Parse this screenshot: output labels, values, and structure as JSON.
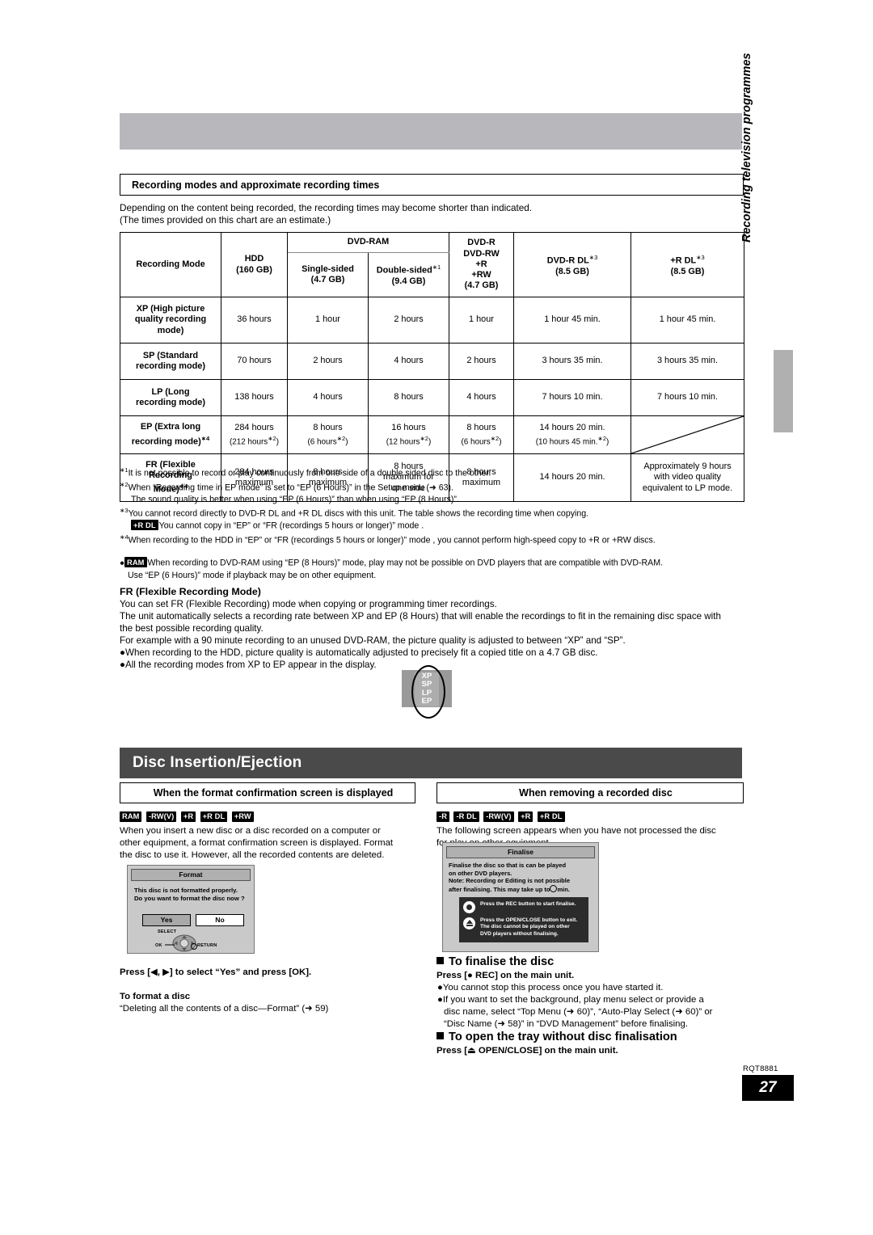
{
  "page": {
    "number": "27",
    "doc_code": "RQT8881",
    "side_tab": "Recording television programmes"
  },
  "section1": {
    "heading": "Recording modes and approximate recording times",
    "intro_line1": "Depending on the content being recorded, the recording times may become shorter than indicated.",
    "intro_line2": "(The times provided on this chart are an estimate.)"
  },
  "chart_data": {
    "type": "table",
    "title": "Recording modes and approximate recording times",
    "columns": [
      {
        "label": "Recording Mode",
        "sub": ""
      },
      {
        "label": "HDD",
        "sub": "(160 GB)"
      },
      {
        "group": "DVD-RAM",
        "label": "Single-sided",
        "sub": "(4.7 GB)"
      },
      {
        "group": "DVD-RAM",
        "label": "Double-sided",
        "footnote": "∗1",
        "sub": "(9.4 GB)"
      },
      {
        "label": "DVD-R\nDVD-RW\n+R\n+RW",
        "sub": "(4.7 GB)"
      },
      {
        "label": "DVD-R DL",
        "footnote": "∗3",
        "sub": "(8.5 GB)"
      },
      {
        "label": "+R DL",
        "footnote": "∗3",
        "sub": "(8.5 GB)"
      }
    ],
    "group_header": "DVD-RAM",
    "col_hdd": "HDD",
    "col_hdd_sub": "(160 GB)",
    "col_ss": "Single-sided",
    "col_ss_sub": "(4.7 GB)",
    "col_ds": "Double-sided",
    "col_ds_sub": "(9.4 GB)",
    "col_dvdr_l1": "DVD-R",
    "col_dvdr_l2": "DVD-RW",
    "col_dvdr_l3": "+R",
    "col_dvdr_l4": "+RW",
    "col_dvdr_sub": "(4.7 GB)",
    "col_dl": "DVD-R DL",
    "col_dl_sub": "(8.5 GB)",
    "col_rdl": "+R DL",
    "col_rdl_sub": "(8.5 GB)",
    "col_mode": "Recording Mode",
    "rows": [
      {
        "mode_l1": "XP (High picture",
        "mode_l2": "quality recording",
        "mode_l3": "mode)",
        "hdd": "36 hours",
        "single": "1 hour",
        "double": "2 hours",
        "dvdr": "1 hour",
        "dl": "1 hour 45 min.",
        "rdl": "1 hour 45 min."
      },
      {
        "mode_l1": "SP (Standard",
        "mode_l2": "recording mode)",
        "mode_l3": "",
        "hdd": "70 hours",
        "single": "2 hours",
        "double": "4 hours",
        "dvdr": "2 hours",
        "dl": "3 hours 35 min.",
        "rdl": "3 hours 35 min."
      },
      {
        "mode_l1": "LP (Long",
        "mode_l2": "recording mode)",
        "mode_l3": "",
        "hdd": "138 hours",
        "single": "4 hours",
        "double": "8 hours",
        "dvdr": "4 hours",
        "dl": "7 hours 10 min.",
        "rdl": "7 hours 10 min."
      },
      {
        "mode_l1": "EP (Extra long",
        "mode_l2": "recording mode)",
        "mode_l3": "",
        "mode_fn": "∗4",
        "hdd": "284 hours",
        "hdd2": "(212 hours",
        "hdd2fn": "∗2",
        "hdd2end": ")",
        "single": "8 hours",
        "single2": "(6 hours",
        "single2fn": "∗2",
        "single2end": ")",
        "double": "16 hours",
        "double2": "(12 hours",
        "double2fn": "∗2",
        "double2end": ")",
        "dvdr": "8 hours",
        "dvdr2": "(6 hours",
        "dvdr2fn": "∗2",
        "dvdr2end": ")",
        "dl": "14 hours 20 min.",
        "dl2": "(10 hours 45 min.",
        "dl2fn": "∗2",
        "dl2end": ")",
        "rdl": ""
      },
      {
        "mode_l1": "FR (Flexible",
        "mode_l2": "Recording",
        "mode_l3": "Mode)",
        "mode_fn": "∗4",
        "hdd": "284 hours",
        "hdd2": "maximum",
        "single": "8 hours",
        "single2": "maximum",
        "double": "8 hours",
        "double2": "maximum for",
        "double3": "one side",
        "dvdr": "8 hours",
        "dvdr2": "maximum",
        "dl": "14 hours 20 min.",
        "rdl": "Approximately 9 hours",
        "rdl2": "with video quality",
        "rdl3": "equivalent to LP mode."
      }
    ]
  },
  "footnotes": [
    {
      "num": "∗1",
      "text": "It is not possible to record or play continuously from one side of a double sided disc to the other."
    },
    {
      "num": "∗2",
      "text": "When “Recording time in EP mode” is set to “EP (6 Hours)” in the Setup menu (➜ 63).",
      "cont": "The sound quality is better when using “EP (6 Hours)” than when using “EP (8 Hours)”."
    },
    {
      "num": "∗3",
      "text": "You cannot record directly to DVD-R DL and +R DL discs with this unit. The table shows the recording time when copying.",
      "badge": "+R DL",
      "cont": "You cannot copy in “EP” or “FR (recordings 5 hours or longer)” mode ."
    },
    {
      "num": "∗4",
      "text": "When recording to the HDD in “EP” or “FR (recordings 5 hours or longer)” mode , you cannot perform high-speed copy to +R or +RW discs."
    }
  ],
  "ram_note": {
    "bullet": "●",
    "badge": "RAM",
    "line1": "When recording to DVD-RAM using “EP (8 Hours)” mode, play may not be possible on DVD players that are compatible with DVD-RAM.",
    "line2": "Use “EP (6 Hours)” mode if playback may be on other equipment."
  },
  "fr_section": {
    "heading": "FR (Flexible Recording Mode)",
    "p1": "You can set FR (Flexible Recording) mode when copying or programming timer recordings.",
    "p2": "The unit automatically selects a recording rate between XP and EP (8 Hours) that will enable the recordings to fit in the remaining disc space with",
    "p3": "the best possible recording quality.",
    "p4": "For example with a 90 minute recording to an unused DVD-RAM, the picture quality is adjusted to between “XP” and “SP”.",
    "b1": "●When recording to the HDD, picture quality is automatically adjusted to precisely fit a copied title on a 4.7 GB disc.",
    "b2": "●All the recording modes from XP to EP appear in the display.",
    "display_modes": "XP\nSP\nLP\nEP"
  },
  "section2": {
    "title": "Disc Insertion/Ejection"
  },
  "left_col": {
    "heading": "When the format confirmation screen is displayed",
    "badges": [
      "RAM",
      "-RW(V)",
      "+R",
      "+R DL",
      "+RW"
    ],
    "body_l1": "When you insert a new disc or a disc recorded on a computer or",
    "body_l2": "other equipment, a format confirmation screen is displayed. Format",
    "body_l3": "the disc to use it. However, all the recorded contents are deleted.",
    "osd": {
      "title": "Format",
      "msg_l1": "This disc is not formatted properly.",
      "msg_l2": "Do you want to format the disc now ?",
      "btn_yes": "Yes",
      "btn_no": "No",
      "nav_select": "SELECT",
      "nav_ok": "OK",
      "nav_return": "RETURN"
    },
    "caption": "Press [◀, ▶] to select “Yes” and press [OK].",
    "sub_heading": "To format a disc",
    "sub_text": "“Deleting all the contents of a disc—Format” (➜ 59)"
  },
  "right_col": {
    "heading": "When removing a recorded disc",
    "badges": [
      "-R",
      "-R DL",
      "-RW(V)",
      "+R",
      "+R DL"
    ],
    "body_l1": "The following screen appears when you have not processed the disc",
    "body_l2": "for play on other equipment.",
    "osd": {
      "title": "Finalise",
      "msg_l1": "Finalise the disc so that is can be played",
      "msg_l2": "on other DVD players.",
      "msg_l3": "Note: Recording or Editing is not possible",
      "msg_l4a": "after finalising. This may take up to",
      "msg_l4b": "min.",
      "item1": "Press the REC button to start finalise.",
      "item2_l1": "Press the OPEN/CLOSE button to exit.",
      "item2_l2": "The disc cannot be played on other",
      "item2_l3": "DVD players without finalising."
    },
    "sec_a": {
      "heading": "To finalise the disc",
      "press": "Press [● REC] on the main unit.",
      "b1": "●You cannot stop this process once you have started it.",
      "b2_l1": "●If you want to set the background, play menu select or provide a",
      "b2_l2": "disc name, select “Top Menu (➜ 60)”, “Auto-Play Select (➜ 60)” or",
      "b2_l3": "“Disc Name (➜ 58)” in “DVD Management” before finalising."
    },
    "sec_b": {
      "heading": "To open the tray without disc finalisation",
      "press": "Press [⏏ OPEN/CLOSE] on the main unit."
    }
  }
}
